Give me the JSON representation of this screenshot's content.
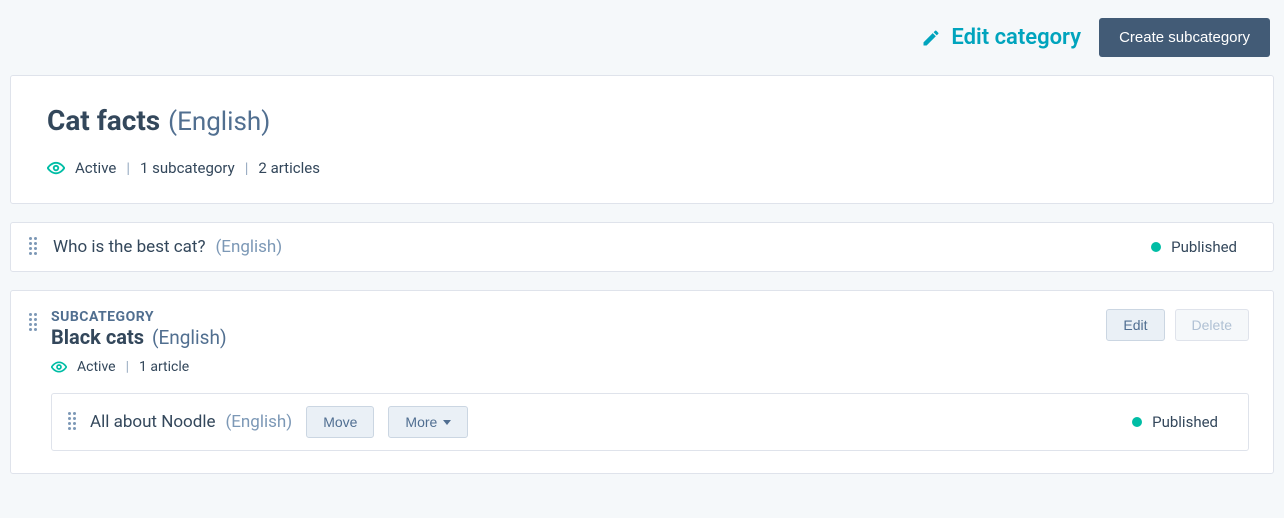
{
  "header": {
    "edit_category_label": "Edit category",
    "create_subcategory_label": "Create subcategory"
  },
  "main_category": {
    "title": "Cat facts",
    "language": "(English)",
    "status": "Active",
    "subcategory_count": "1 subcategory",
    "article_count": "2 articles"
  },
  "article1": {
    "title": "Who is the best cat?",
    "language": "(English)",
    "status": "Published"
  },
  "subcategory": {
    "label": "SUBCATEGORY",
    "title": "Black cats",
    "language": "(English)",
    "status": "Active",
    "article_count": "1 article",
    "edit_label": "Edit",
    "delete_label": "Delete",
    "article": {
      "title": "All about Noodle",
      "language": "(English)",
      "move_label": "Move",
      "more_label": "More",
      "status": "Published"
    }
  }
}
